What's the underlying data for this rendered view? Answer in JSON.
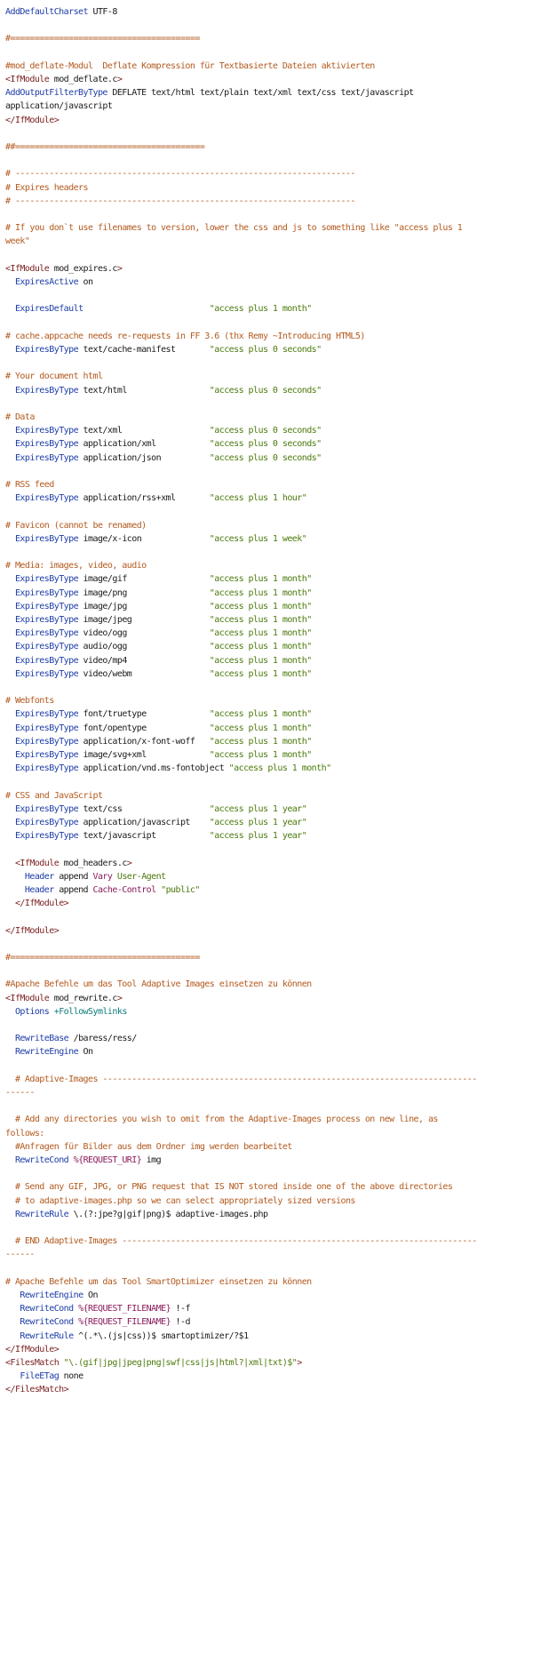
{
  "colors": {
    "directive": "#1d3da8",
    "comment": "#b35a1f",
    "tag": "#7a1f1f",
    "string": "#4c7a0c",
    "keyword": "#0e7a7a",
    "variable": "#8a1c5c",
    "plain": "#1a1a1a",
    "background": "#ffffff"
  },
  "lines": [
    [
      [
        "dir",
        "AddDefaultCharset"
      ],
      [
        "plain",
        " UTF-8"
      ]
    ],
    [],
    [
      [
        "cmt",
        "#======================================="
      ]
    ],
    [],
    [
      [
        "cmt",
        "#mod_deflate-Modul  Deflate Kompression für Textbasierte Dateien aktivierten"
      ]
    ],
    [
      [
        "tag",
        "<IfModule"
      ],
      [
        "plain",
        " mod_deflate.c"
      ],
      [
        "tag",
        ">"
      ]
    ],
    [
      [
        "dir",
        "AddOutputFilterByType"
      ],
      [
        "plain",
        " DEFLATE text/html text/plain text/xml text/css text/javascript"
      ]
    ],
    [
      [
        "plain",
        "application/javascript"
      ]
    ],
    [
      [
        "tag",
        "</IfModule>"
      ]
    ],
    [],
    [
      [
        "cmt",
        "##======================================="
      ]
    ],
    [],
    [
      [
        "cmt",
        "# ----------------------------------------------------------------------"
      ]
    ],
    [
      [
        "cmt",
        "# Expires headers"
      ]
    ],
    [
      [
        "cmt",
        "# ----------------------------------------------------------------------"
      ]
    ],
    [],
    [
      [
        "cmt",
        "# If you don`t use filenames to version, lower the css and js to something like \"access plus 1"
      ]
    ],
    [
      [
        "cmt",
        "week\""
      ]
    ],
    [],
    [
      [
        "tag",
        "<IfModule"
      ],
      [
        "plain",
        " mod_expires.c"
      ],
      [
        "tag",
        ">"
      ]
    ],
    [
      [
        "plain",
        "  "
      ],
      [
        "dir",
        "ExpiresActive"
      ],
      [
        "plain",
        " on"
      ]
    ],
    [],
    [
      [
        "plain",
        "  "
      ],
      [
        "dir",
        "ExpiresDefault"
      ],
      [
        "plain",
        "                          "
      ],
      [
        "str",
        "\"access plus 1 month\""
      ]
    ],
    [],
    [
      [
        "cmt",
        "# cache.appcache needs re-requests in FF 3.6 (thx Remy ~Introducing HTML5)"
      ]
    ],
    [
      [
        "plain",
        "  "
      ],
      [
        "dir",
        "ExpiresByType"
      ],
      [
        "plain",
        " text/cache-manifest       "
      ],
      [
        "str",
        "\"access plus 0 seconds\""
      ]
    ],
    [],
    [
      [
        "cmt",
        "# Your document html"
      ]
    ],
    [
      [
        "plain",
        "  "
      ],
      [
        "dir",
        "ExpiresByType"
      ],
      [
        "plain",
        " text/html                 "
      ],
      [
        "str",
        "\"access plus 0 seconds\""
      ]
    ],
    [],
    [
      [
        "cmt",
        "# Data"
      ]
    ],
    [
      [
        "plain",
        "  "
      ],
      [
        "dir",
        "ExpiresByType"
      ],
      [
        "plain",
        " text/xml                  "
      ],
      [
        "str",
        "\"access plus 0 seconds\""
      ]
    ],
    [
      [
        "plain",
        "  "
      ],
      [
        "dir",
        "ExpiresByType"
      ],
      [
        "plain",
        " application/xml           "
      ],
      [
        "str",
        "\"access plus 0 seconds\""
      ]
    ],
    [
      [
        "plain",
        "  "
      ],
      [
        "dir",
        "ExpiresByType"
      ],
      [
        "plain",
        " application/json          "
      ],
      [
        "str",
        "\"access plus 0 seconds\""
      ]
    ],
    [],
    [
      [
        "cmt",
        "# RSS feed"
      ]
    ],
    [
      [
        "plain",
        "  "
      ],
      [
        "dir",
        "ExpiresByType"
      ],
      [
        "plain",
        " application/rss+xml       "
      ],
      [
        "str",
        "\"access plus 1 hour\""
      ]
    ],
    [],
    [
      [
        "cmt",
        "# Favicon (cannot be renamed)"
      ]
    ],
    [
      [
        "plain",
        "  "
      ],
      [
        "dir",
        "ExpiresByType"
      ],
      [
        "plain",
        " image/x-icon              "
      ],
      [
        "str",
        "\"access plus 1 week\""
      ]
    ],
    [],
    [
      [
        "cmt",
        "# Media: images, video, audio"
      ]
    ],
    [
      [
        "plain",
        "  "
      ],
      [
        "dir",
        "ExpiresByType"
      ],
      [
        "plain",
        " image/gif                 "
      ],
      [
        "str",
        "\"access plus 1 month\""
      ]
    ],
    [
      [
        "plain",
        "  "
      ],
      [
        "dir",
        "ExpiresByType"
      ],
      [
        "plain",
        " image/png                 "
      ],
      [
        "str",
        "\"access plus 1 month\""
      ]
    ],
    [
      [
        "plain",
        "  "
      ],
      [
        "dir",
        "ExpiresByType"
      ],
      [
        "plain",
        " image/jpg                 "
      ],
      [
        "str",
        "\"access plus 1 month\""
      ]
    ],
    [
      [
        "plain",
        "  "
      ],
      [
        "dir",
        "ExpiresByType"
      ],
      [
        "plain",
        " image/jpeg                "
      ],
      [
        "str",
        "\"access plus 1 month\""
      ]
    ],
    [
      [
        "plain",
        "  "
      ],
      [
        "dir",
        "ExpiresByType"
      ],
      [
        "plain",
        " video/ogg                 "
      ],
      [
        "str",
        "\"access plus 1 month\""
      ]
    ],
    [
      [
        "plain",
        "  "
      ],
      [
        "dir",
        "ExpiresByType"
      ],
      [
        "plain",
        " audio/ogg                 "
      ],
      [
        "str",
        "\"access plus 1 month\""
      ]
    ],
    [
      [
        "plain",
        "  "
      ],
      [
        "dir",
        "ExpiresByType"
      ],
      [
        "plain",
        " video/mp4                 "
      ],
      [
        "str",
        "\"access plus 1 month\""
      ]
    ],
    [
      [
        "plain",
        "  "
      ],
      [
        "dir",
        "ExpiresByType"
      ],
      [
        "plain",
        " video/webm                "
      ],
      [
        "str",
        "\"access plus 1 month\""
      ]
    ],
    [],
    [
      [
        "cmt",
        "# Webfonts"
      ]
    ],
    [
      [
        "plain",
        "  "
      ],
      [
        "dir",
        "ExpiresByType"
      ],
      [
        "plain",
        " font/truetype             "
      ],
      [
        "str",
        "\"access plus 1 month\""
      ]
    ],
    [
      [
        "plain",
        "  "
      ],
      [
        "dir",
        "ExpiresByType"
      ],
      [
        "plain",
        " font/opentype             "
      ],
      [
        "str",
        "\"access plus 1 month\""
      ]
    ],
    [
      [
        "plain",
        "  "
      ],
      [
        "dir",
        "ExpiresByType"
      ],
      [
        "plain",
        " application/x-font-woff   "
      ],
      [
        "str",
        "\"access plus 1 month\""
      ]
    ],
    [
      [
        "plain",
        "  "
      ],
      [
        "dir",
        "ExpiresByType"
      ],
      [
        "plain",
        " image/svg+xml             "
      ],
      [
        "str",
        "\"access plus 1 month\""
      ]
    ],
    [
      [
        "plain",
        "  "
      ],
      [
        "dir",
        "ExpiresByType"
      ],
      [
        "plain",
        " application/vnd.ms-fontobject "
      ],
      [
        "str",
        "\"access plus 1 month\""
      ]
    ],
    [],
    [
      [
        "cmt",
        "# CSS and JavaScript"
      ]
    ],
    [
      [
        "plain",
        "  "
      ],
      [
        "dir",
        "ExpiresByType"
      ],
      [
        "plain",
        " text/css                  "
      ],
      [
        "str",
        "\"access plus 1 year\""
      ]
    ],
    [
      [
        "plain",
        "  "
      ],
      [
        "dir",
        "ExpiresByType"
      ],
      [
        "plain",
        " application/javascript    "
      ],
      [
        "str",
        "\"access plus 1 year\""
      ]
    ],
    [
      [
        "plain",
        "  "
      ],
      [
        "dir",
        "ExpiresByType"
      ],
      [
        "plain",
        " text/javascript           "
      ],
      [
        "str",
        "\"access plus 1 year\""
      ]
    ],
    [],
    [
      [
        "plain",
        "  "
      ],
      [
        "tag",
        "<IfModule"
      ],
      [
        "plain",
        " mod_headers.c"
      ],
      [
        "tag",
        ">"
      ]
    ],
    [
      [
        "plain",
        "    "
      ],
      [
        "dir",
        "Header"
      ],
      [
        "plain",
        " append "
      ],
      [
        "var",
        "Vary"
      ],
      [
        "plain",
        " "
      ],
      [
        "str",
        "User-Agent"
      ]
    ],
    [
      [
        "plain",
        "    "
      ],
      [
        "dir",
        "Header"
      ],
      [
        "plain",
        " append "
      ],
      [
        "var",
        "Cache-Control"
      ],
      [
        "plain",
        " "
      ],
      [
        "str",
        "\"public\""
      ]
    ],
    [
      [
        "plain",
        "  "
      ],
      [
        "tag",
        "</IfModule>"
      ]
    ],
    [],
    [
      [
        "tag",
        "</IfModule>"
      ]
    ],
    [],
    [
      [
        "cmt",
        "#======================================="
      ]
    ],
    [],
    [
      [
        "cmt",
        "#Apache Befehle um das Tool Adaptive Images einsetzen zu können"
      ]
    ],
    [
      [
        "tag",
        "<IfModule"
      ],
      [
        "plain",
        " mod_rewrite.c"
      ],
      [
        "tag",
        ">"
      ]
    ],
    [
      [
        "plain",
        "  "
      ],
      [
        "dir",
        "Options"
      ],
      [
        "plain",
        " "
      ],
      [
        "kw",
        "+FollowSymlinks"
      ]
    ],
    [],
    [
      [
        "plain",
        "  "
      ],
      [
        "dir",
        "RewriteBase"
      ],
      [
        "plain",
        " /baress/ress/"
      ]
    ],
    [
      [
        "plain",
        "  "
      ],
      [
        "dir",
        "RewriteEngine"
      ],
      [
        "plain",
        " On"
      ]
    ],
    [],
    [
      [
        "plain",
        "  "
      ],
      [
        "cmt",
        "# Adaptive-Images -----------------------------------------------------------------------------"
      ]
    ],
    [
      [
        "cmt",
        "------"
      ]
    ],
    [],
    [
      [
        "plain",
        "  "
      ],
      [
        "cmt",
        "# Add any directories you wish to omit from the Adaptive-Images process on new line, as"
      ]
    ],
    [
      [
        "cmt",
        "follows:"
      ]
    ],
    [
      [
        "plain",
        "  "
      ],
      [
        "cmt",
        "#Anfragen für Bilder aus dem Ordner img werden bearbeitet"
      ]
    ],
    [
      [
        "plain",
        "  "
      ],
      [
        "dir",
        "RewriteCond"
      ],
      [
        "plain",
        " "
      ],
      [
        "var",
        "%{REQUEST_URI}"
      ],
      [
        "plain",
        " img"
      ]
    ],
    [],
    [
      [
        "plain",
        "  "
      ],
      [
        "cmt",
        "# Send any GIF, JPG, or PNG request that IS NOT stored inside one of the above directories"
      ]
    ],
    [
      [
        "plain",
        "  "
      ],
      [
        "cmt",
        "# to adaptive-images.php so we can select appropriately sized versions"
      ]
    ],
    [
      [
        "plain",
        "  "
      ],
      [
        "dir",
        "RewriteRule"
      ],
      [
        "plain",
        " \\.(?:jpe?g|gif|png)$ adaptive-images.php"
      ]
    ],
    [],
    [
      [
        "plain",
        "  "
      ],
      [
        "cmt",
        "# END Adaptive-Images -------------------------------------------------------------------------"
      ]
    ],
    [
      [
        "cmt",
        "------"
      ]
    ],
    [],
    [
      [
        "cmt",
        "# Apache Befehle um das Tool SmartOptimizer einsetzen zu können"
      ]
    ],
    [
      [
        "plain",
        "   "
      ],
      [
        "dir",
        "RewriteEngine"
      ],
      [
        "plain",
        " On"
      ]
    ],
    [
      [
        "plain",
        "   "
      ],
      [
        "dir",
        "RewriteCond"
      ],
      [
        "plain",
        " "
      ],
      [
        "var",
        "%{REQUEST_FILENAME}"
      ],
      [
        "plain",
        " !-f"
      ]
    ],
    [
      [
        "plain",
        "   "
      ],
      [
        "dir",
        "RewriteCond"
      ],
      [
        "plain",
        " "
      ],
      [
        "var",
        "%{REQUEST_FILENAME}"
      ],
      [
        "plain",
        " !-d"
      ]
    ],
    [
      [
        "plain",
        "   "
      ],
      [
        "dir",
        "RewriteRule"
      ],
      [
        "plain",
        " ^(.*\\.(js|css))$ smartoptimizer/?$1"
      ]
    ],
    [
      [
        "tag",
        "</IfModule>"
      ]
    ],
    [
      [
        "tag",
        "<FilesMatch"
      ],
      [
        "plain",
        " "
      ],
      [
        "str",
        "\"\\.(gif|jpg|jpeg|png|swf|css|js|html?|xml|txt)$\""
      ],
      [
        "tag",
        ">"
      ]
    ],
    [
      [
        "plain",
        "   "
      ],
      [
        "dir",
        "FileETag"
      ],
      [
        "plain",
        " none"
      ]
    ],
    [
      [
        "tag",
        "</FilesMatch>"
      ]
    ]
  ]
}
